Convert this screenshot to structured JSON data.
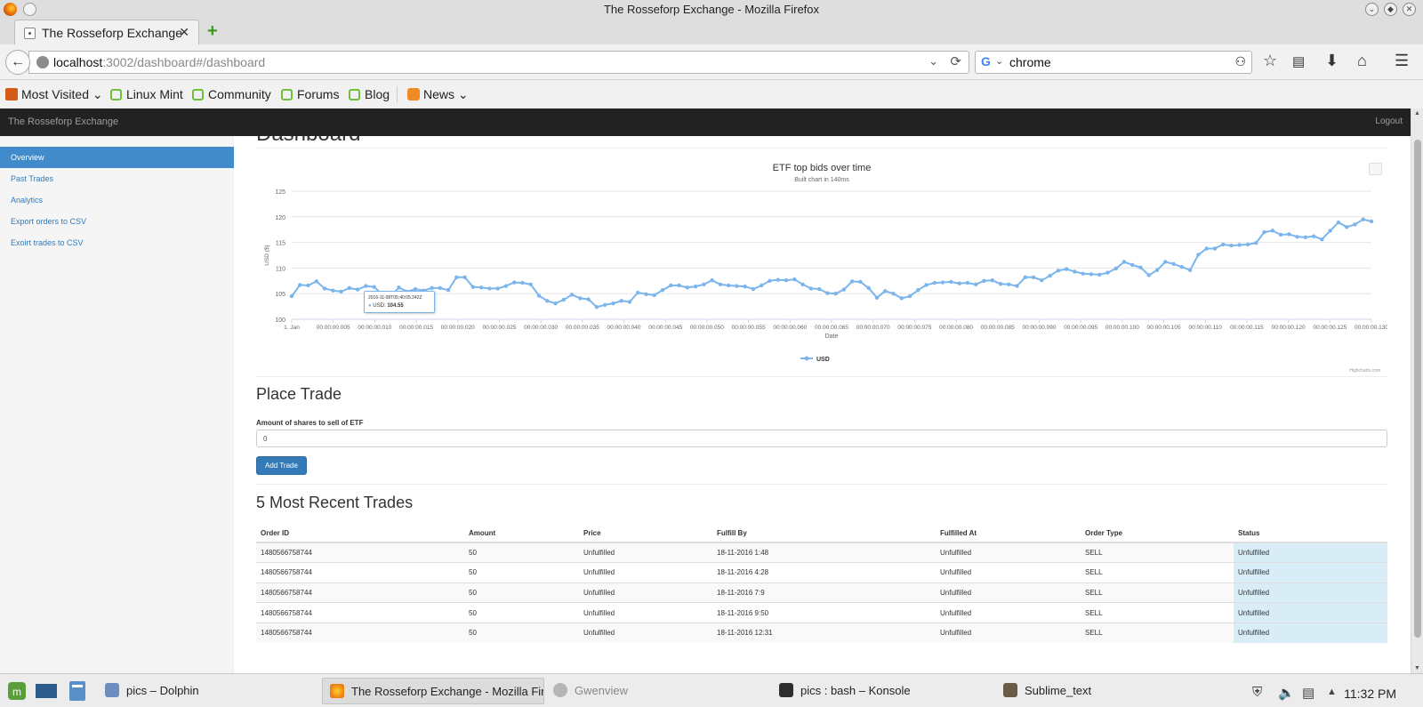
{
  "window": {
    "title": "The Rosseforp Exchange - Mozilla Firefox"
  },
  "browser": {
    "tab_title": "The Rosseforp Exchange",
    "url_host": "localhost",
    "url_rest": ":3002/dashboard#/dashboard",
    "search_value": "chrome",
    "bookmarks": [
      "Most Visited",
      "Linux Mint",
      "Community",
      "Forums",
      "Blog",
      "News"
    ]
  },
  "app": {
    "brand": "The Rosseforp Exchange",
    "logout": "Logout",
    "sidebar": [
      {
        "label": "Overview",
        "active": true
      },
      {
        "label": "Past Trades",
        "active": false
      },
      {
        "label": "Analytics",
        "active": false
      },
      {
        "label": "Export orders to CSV",
        "active": false
      },
      {
        "label": "Exoirt trades to CSV",
        "active": false
      }
    ],
    "page_title": "Dashboard"
  },
  "tooltip": {
    "date": "2016-11-08T05:40:05.242Z",
    "series": "USD",
    "value": "104.55"
  },
  "chart_data": {
    "type": "line",
    "title": "ETF top bids over time",
    "subtitle": "Built chart in 140ms",
    "xlabel": "Date",
    "ylabel": "USD ($)",
    "ylim": [
      100,
      125
    ],
    "yticks": [
      100,
      105,
      110,
      115,
      120,
      125
    ],
    "xtick_labels": [
      "1. Jan",
      "00:00:00.005",
      "00:00:00.010",
      "00:00:00.015",
      "00:00:00.020",
      "00:00:00.025",
      "00:00:00.030",
      "00:00:00.035",
      "00:00:00.040",
      "00:00:00.045",
      "00:00:00.050",
      "00:00:00.055",
      "00:00:00.060",
      "00:00:00.065",
      "00:00:00.070",
      "00:00:00.075",
      "00:00:00.080",
      "00:00:00.085",
      "00:00:00.090",
      "00:00:00.095",
      "00:00:00.100",
      "00:00:00.105",
      "00:00:00.110",
      "00:00:00.115",
      "00:00:00.120",
      "00:00:00.125",
      "00:00:00.130"
    ],
    "series": [
      {
        "name": "USD",
        "color": "#7cb5ec",
        "values": [
          104.5,
          106.7,
          106.6,
          107.4,
          106.0,
          105.6,
          105.4,
          106.1,
          105.8,
          106.5,
          106.3,
          104.8,
          104.5,
          106.2,
          105.4,
          105.9,
          105.6,
          106.1,
          106.1,
          105.7,
          108.2,
          108.2,
          106.3,
          106.2,
          106.0,
          106.0,
          106.5,
          107.2,
          107.1,
          106.8,
          104.6,
          103.6,
          103.1,
          103.8,
          104.8,
          104.1,
          103.9,
          102.4,
          102.8,
          103.1,
          103.6,
          103.4,
          105.2,
          104.9,
          104.7,
          105.7,
          106.6,
          106.6,
          106.2,
          106.4,
          106.8,
          107.6,
          106.8,
          106.6,
          106.5,
          106.4,
          105.9,
          106.6,
          107.5,
          107.7,
          107.6,
          107.8,
          106.8,
          106.0,
          105.9,
          105.1,
          105.0,
          105.8,
          107.4,
          107.3,
          106.1,
          104.2,
          105.5,
          105.0,
          104.1,
          104.5,
          105.7,
          106.7,
          107.1,
          107.2,
          107.3,
          107.0,
          107.1,
          106.8,
          107.5,
          107.6,
          106.9,
          106.8,
          106.5,
          108.2,
          108.2,
          107.6,
          108.5,
          109.5,
          109.8,
          109.3,
          108.9,
          108.8,
          108.7,
          109.1,
          109.9,
          111.2,
          110.6,
          110.1,
          108.6,
          109.6,
          111.2,
          110.8,
          110.2,
          109.6,
          112.6,
          113.8,
          113.8,
          114.6,
          114.4,
          114.5,
          114.6,
          114.9,
          117.0,
          117.3,
          116.5,
          116.6,
          116.1,
          116.0,
          116.2,
          115.6,
          117.3,
          118.9,
          118.0,
          118.5,
          119.5,
          119.1
        ]
      }
    ],
    "legend": "bottom-center",
    "credits": "Highcharts.com"
  },
  "place_trade": {
    "title": "Place Trade",
    "label": "Amount of shares to sell of ETF",
    "value": "0",
    "button": "Add Trade"
  },
  "recent": {
    "title": "5 Most Recent Trades",
    "headers": [
      "Order ID",
      "Amount",
      "Price",
      "Fulfill By",
      "Fulfilled At",
      "Order Type",
      "Status"
    ],
    "rows": [
      [
        "1480566758744",
        "50",
        "Unfulfilled",
        "18-11-2016 1:48",
        "Unfulfilled",
        "SELL",
        "Unfulfilled"
      ],
      [
        "1480566758744",
        "50",
        "Unfulfilled",
        "18-11-2016 4:28",
        "Unfulfilled",
        "SELL",
        "Unfulfilled"
      ],
      [
        "1480566758744",
        "50",
        "Unfulfilled",
        "18-11-2016 7:9",
        "Unfulfilled",
        "SELL",
        "Unfulfilled"
      ],
      [
        "1480566758744",
        "50",
        "Unfulfilled",
        "18-11-2016 9:50",
        "Unfulfilled",
        "SELL",
        "Unfulfilled"
      ],
      [
        "1480566758744",
        "50",
        "Unfulfilled",
        "18-11-2016 12:31",
        "Unfulfilled",
        "SELL",
        "Unfulfilled"
      ]
    ]
  },
  "taskbar": {
    "items": [
      "pics – Dolphin",
      "The Rosseforp Exchange - Mozilla Firef",
      "Gwenview",
      "pics : bash – Konsole",
      "Sublime_text"
    ],
    "clock": "11:32 PM"
  }
}
